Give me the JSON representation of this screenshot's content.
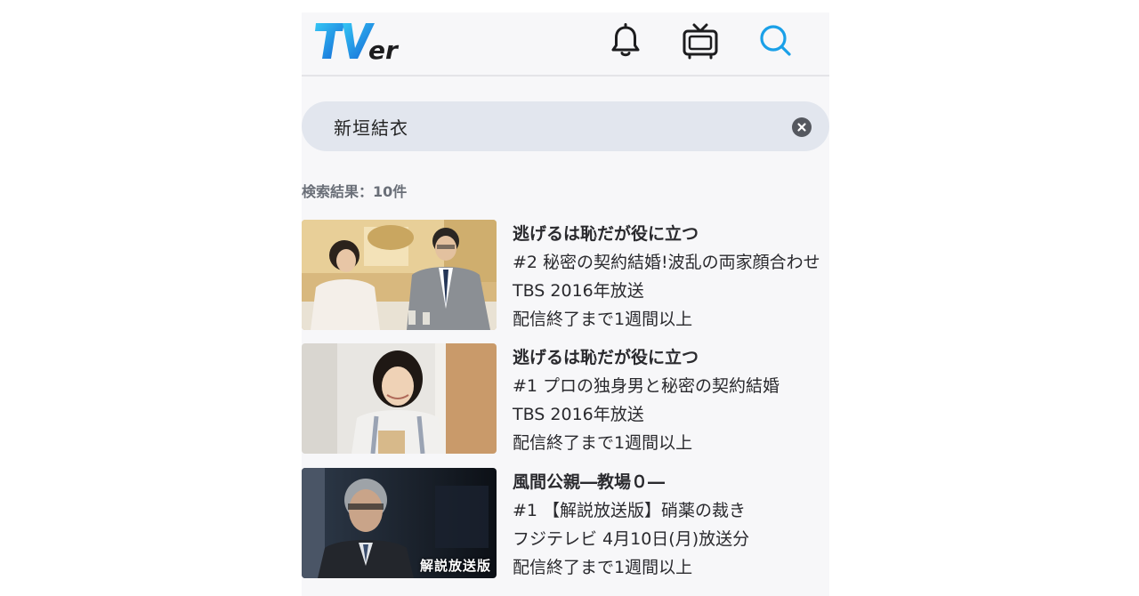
{
  "header": {
    "logo_text": "TVer",
    "icons": [
      "bell-icon",
      "tv-icon",
      "search-icon"
    ],
    "accent_color": "#1aa0e8"
  },
  "search": {
    "query": "新垣結衣"
  },
  "results": {
    "count_label": "検索結果：10件",
    "items": [
      {
        "title": "逃げるは恥だが役に立つ",
        "episode": "#2 秘密の契約結婚!波乱の両家顔合わせ",
        "broadcast": "TBS 2016年放送",
        "availability": "配信終了まで1週間以上"
      },
      {
        "title": "逃げるは恥だが役に立つ",
        "episode": "#1 プロの独身男と秘密の契約結婚",
        "broadcast": "TBS 2016年放送",
        "availability": "配信終了まで1週間以上"
      },
      {
        "title": "風間公親―教場０―",
        "episode": "#1 【解説放送版】硝薬の裁き",
        "broadcast": "フジテレビ 4月10日(月)放送分",
        "availability": "配信終了まで1週間以上",
        "badge": "解説放送版"
      }
    ]
  }
}
